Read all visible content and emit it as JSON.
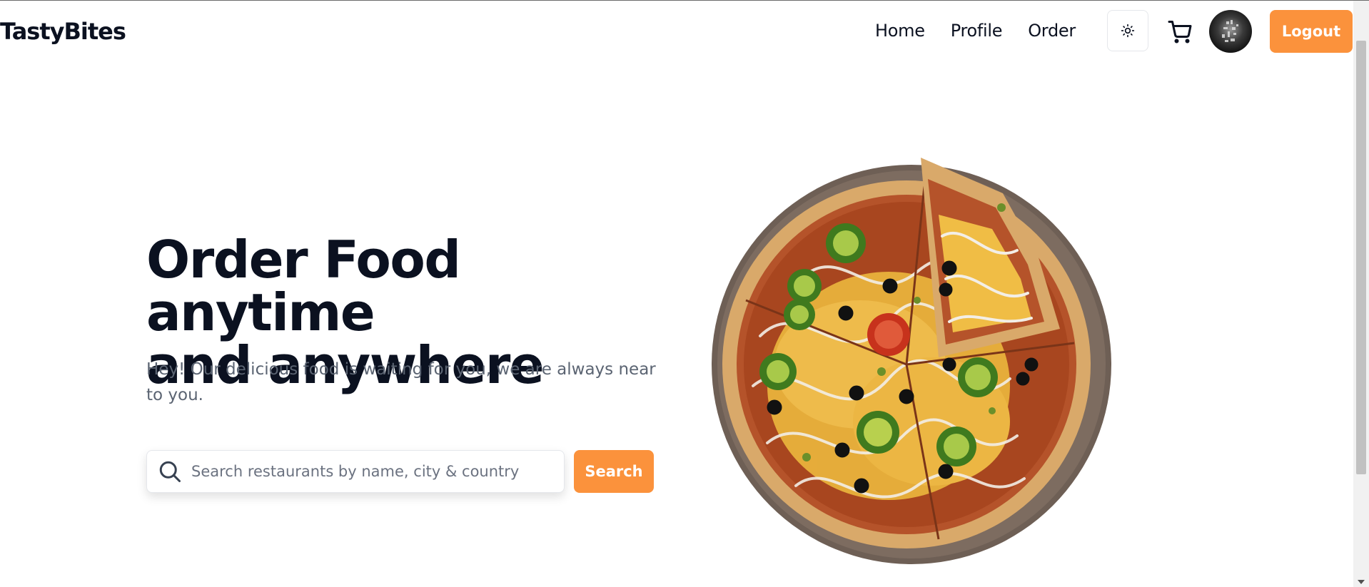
{
  "header": {
    "brand": "TastyBites",
    "nav": [
      {
        "label": "Home"
      },
      {
        "label": "Profile"
      },
      {
        "label": "Order"
      }
    ],
    "theme_icon": "sun-icon",
    "cart_icon": "cart-icon",
    "logout_label": "Logout"
  },
  "hero": {
    "title_line1": "Order Food anytime",
    "title_line2": "and anywhere",
    "subtitle": "Hey! Our delicious food is waiting for you, we are always near to you.",
    "search_placeholder": "Search restaurants by name, city & country",
    "search_button": "Search",
    "image": "pizza-image"
  },
  "colors": {
    "accent": "#fb923c",
    "text": "#0b1120",
    "muted": "#5b6472"
  }
}
